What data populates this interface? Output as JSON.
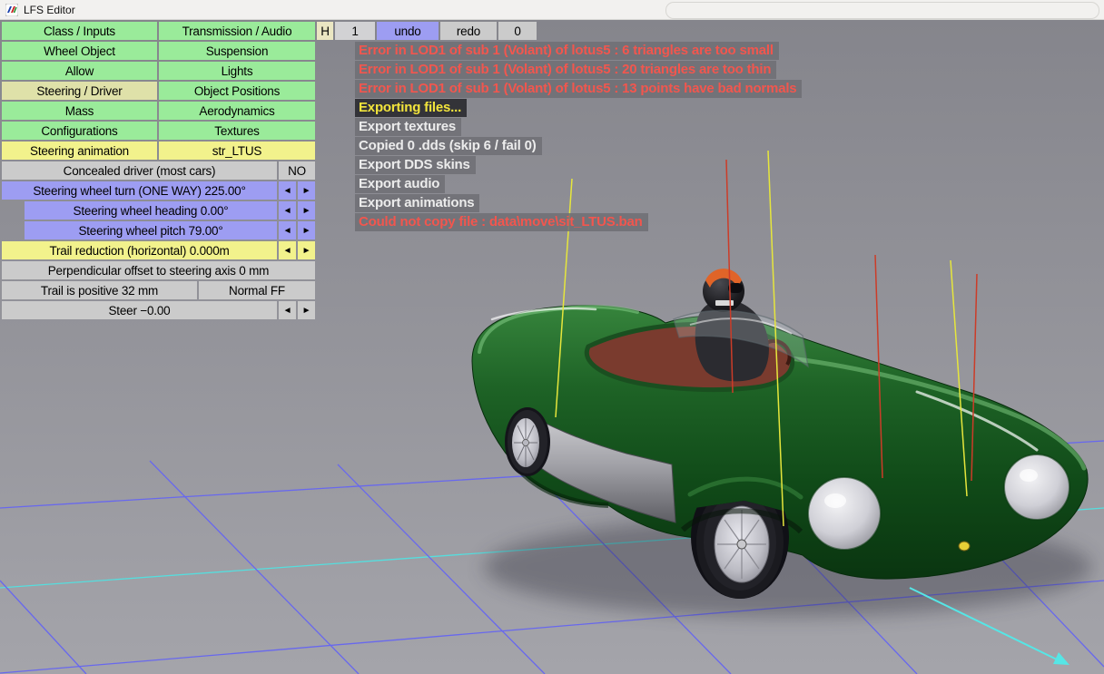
{
  "titlebar": {
    "title": "LFS Editor"
  },
  "toolbar": {
    "h": "H",
    "one": "1",
    "undo": "undo",
    "redo": "redo",
    "zero": "0"
  },
  "nav": {
    "class_inputs": "Class / Inputs",
    "transmission_audio": "Transmission / Audio",
    "wheel_object": "Wheel Object",
    "suspension": "Suspension",
    "allow": "Allow",
    "lights": "Lights",
    "steering_driver": "Steering / Driver",
    "object_positions": "Object Positions",
    "mass": "Mass",
    "aerodynamics": "Aerodynamics",
    "configurations": "Configurations",
    "textures": "Textures"
  },
  "steering": {
    "animation_label": "Steering animation",
    "animation_value": "str_LTUS",
    "concealed_label": "Concealed driver (most cars)",
    "concealed_value": "NO",
    "turn": "Steering wheel turn (ONE WAY) 225.00°",
    "heading": "Steering wheel heading 0.00°",
    "pitch": "Steering wheel pitch 79.00°",
    "trail_reduction": "Trail reduction (horizontal) 0.000m",
    "perp_offset": "Perpendicular offset to steering axis 0 mm",
    "trail_positive": "Trail is positive 32 mm",
    "force_feedback": "Normal FF",
    "steer": "Steer −0.00",
    "dec": "◄",
    "inc": "►"
  },
  "console": {
    "messages": [
      {
        "text": "Error in LOD1 of sub 1 (Volant) of lotus5 : 6 triangles are too small",
        "type": "error"
      },
      {
        "text": "Error in LOD1 of sub 1 (Volant) of lotus5 : 20 triangles are too thin",
        "type": "error"
      },
      {
        "text": "Error in LOD1 of sub 1 (Volant) of lotus5 : 13 points have bad normals",
        "type": "error"
      },
      {
        "text": "Exporting files...",
        "type": "highlight"
      },
      {
        "text": "Export textures",
        "type": "info"
      },
      {
        "text": "Copied 0 .dds (skip 6 / fail 0)",
        "type": "info"
      },
      {
        "text": "Export DDS skins",
        "type": "info"
      },
      {
        "text": "Export audio",
        "type": "info"
      },
      {
        "text": "Export animations",
        "type": "info"
      },
      {
        "text": "Could not copy file : data\\move\\sit_LTUS.ban",
        "type": "error"
      }
    ]
  },
  "colors": {
    "button_green": "#9aeb9a",
    "button_selected": "#dfe1a9",
    "button_yellow": "#f2f28c",
    "button_purple": "#9d9df2",
    "button_gray": "#cbcbcb",
    "error_text": "#f2564e",
    "highlight_text": "#f2e43c",
    "info_text": "#ececec",
    "grid_blue": "#6868ee",
    "grid_cyan": "#55e6e6",
    "car_green": "#1e6326"
  }
}
